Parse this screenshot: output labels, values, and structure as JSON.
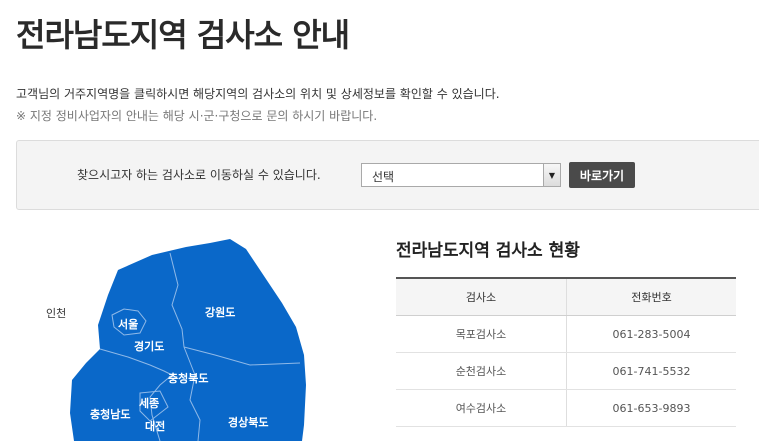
{
  "page": {
    "title": "전라남도지역 검사소 안내",
    "intro": "고객님의 거주지역명을 클릭하시면 해당지역의 검사소의 위치 및 상세정보를 확인할 수 있습니다.",
    "note": "※ 지정 정비사업자의 안내는 해당 시·군·구청으로 문의 하시기 바랍니다."
  },
  "search": {
    "label": "찾으시고자 하는 검사소로 이동하실 수 있습니다.",
    "select_value": "선택",
    "button_label": "바로가기"
  },
  "map": {
    "fill_color": "#0a68c9",
    "regions": {
      "incheon": "인천",
      "seoul": "서울",
      "gyeonggi": "경기도",
      "gangwon": "강원도",
      "chungbuk": "충청북도",
      "chungnam": "충청남도",
      "sejong": "세종",
      "daejeon": "대전",
      "gyeongbuk": "경상북도"
    }
  },
  "status": {
    "title": "전라남도지역 검사소 현황",
    "headers": [
      "검사소",
      "전화번호"
    ],
    "rows": [
      {
        "name": "목포검사소",
        "phone": "061-283-5004"
      },
      {
        "name": "순천검사소",
        "phone": "061-741-5532"
      },
      {
        "name": "여수검사소",
        "phone": "061-653-9893"
      }
    ]
  }
}
